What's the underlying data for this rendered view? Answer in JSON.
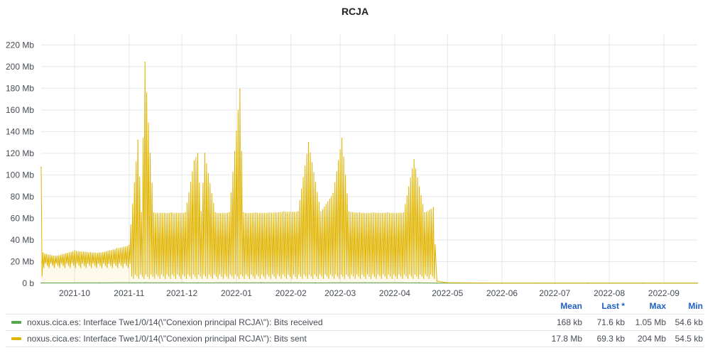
{
  "panel": {
    "title": "RCJA"
  },
  "chart_data": {
    "type": "line",
    "title": "RCJA",
    "ylim": [
      0,
      230
    ],
    "xlim": [
      "2021-09-12",
      "2022-09-20"
    ],
    "yticks": [
      0,
      20,
      40,
      60,
      80,
      100,
      120,
      140,
      160,
      180,
      200,
      220
    ],
    "ytick_labels": [
      "0 b",
      "20 Mb",
      "40 Mb",
      "60 Mb",
      "80 Mb",
      "100 Mb",
      "120 Mb",
      "140 Mb",
      "160 Mb",
      "180 Mb",
      "200 Mb",
      "220 Mb"
    ],
    "xticks": [
      "2021-10-01",
      "2021-11-01",
      "2021-12-01",
      "2022-01-01",
      "2022-02-01",
      "2022-03-01",
      "2022-04-01",
      "2022-05-01",
      "2022-06-01",
      "2022-07-01",
      "2022-08-01",
      "2022-09-01"
    ],
    "xtick_labels": [
      "2021-10",
      "2021-11",
      "2021-12",
      "2022-01",
      "2022-02",
      "2022-03",
      "2022-04",
      "2022-05",
      "2022-06",
      "2022-07",
      "2022-08",
      "2022-09"
    ],
    "grid": true,
    "series": [
      {
        "name": "noxus.cica.es: Interface Twe1/0/14(\\\"Conexion principal RCJA\\\"): Bits received",
        "color": "#56a64b",
        "x": [
          "2021-09-12",
          "2021-10-15",
          "2021-11-10",
          "2021-12-10",
          "2022-01-15",
          "2022-02-15",
          "2022-03-15",
          "2022-04-15",
          "2022-04-25",
          "2022-05-20",
          "2022-06-20",
          "2022-07-20",
          "2022-08-20",
          "2022-09-20"
        ],
        "y": [
          0.3,
          0.4,
          0.5,
          0.4,
          0.5,
          0.4,
          0.5,
          0.4,
          0.2,
          0.17,
          0.17,
          0.17,
          0.17,
          0.17
        ]
      },
      {
        "name": "noxus.cica.es: Interface Twe1/0/14(\\\"Conexion principal RCJA\\\"): Bits sent",
        "color": "#e0b400",
        "x": [
          "2021-09-12",
          "2021-09-13",
          "2021-09-20",
          "2021-10-01",
          "2021-10-15",
          "2021-10-25",
          "2021-11-01",
          "2021-11-06",
          "2021-11-08",
          "2021-11-10",
          "2021-11-15",
          "2021-11-25",
          "2021-12-03",
          "2021-12-08",
          "2021-12-10",
          "2021-12-12",
          "2021-12-14",
          "2021-12-20",
          "2021-12-28",
          "2022-01-03",
          "2022-01-05",
          "2022-01-12",
          "2022-01-20",
          "2022-01-28",
          "2022-02-05",
          "2022-02-11",
          "2022-02-18",
          "2022-02-25",
          "2022-03-02",
          "2022-03-06",
          "2022-03-12",
          "2022-03-20",
          "2022-03-28",
          "2022-04-06",
          "2022-04-12",
          "2022-04-18",
          "2022-04-23",
          "2022-04-25",
          "2022-05-01",
          "2022-06-01",
          "2022-07-01",
          "2022-08-01",
          "2022-09-20"
        ],
        "y": [
          107,
          28,
          25,
          30,
          28,
          32,
          35,
          132,
          65,
          204,
          65,
          65,
          65,
          113,
          120,
          66,
          120,
          65,
          65,
          179,
          65,
          65,
          65,
          66,
          66,
          130,
          66,
          83,
          134,
          66,
          65,
          65,
          65,
          65,
          114,
          65,
          70,
          2,
          0.5,
          0.2,
          0.2,
          0.2,
          0.2
        ]
      }
    ]
  },
  "legend": {
    "headers": {
      "mean": "Mean",
      "last": "Last *",
      "max": "Max",
      "min": "Min"
    },
    "rows": [
      {
        "name": "noxus.cica.es: Interface Twe1/0/14(\\\"Conexion principal RCJA\\\"): Bits received",
        "color": "#56a64b",
        "mean": "168 kb",
        "last": "71.6 kb",
        "max": "1.05 Mb",
        "min": "54.6 kb"
      },
      {
        "name": "noxus.cica.es: Interface Twe1/0/14(\\\"Conexion principal RCJA\\\"): Bits sent",
        "color": "#e0b400",
        "mean": "17.8 Mb",
        "last": "69.3 kb",
        "max": "204 Mb",
        "min": "54.5 kb"
      }
    ]
  }
}
